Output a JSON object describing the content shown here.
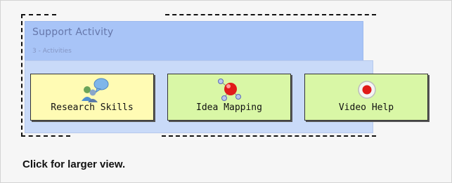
{
  "activity_panel": {
    "title": "Support Activity",
    "subtitle": "3 - Activities",
    "buttons": [
      {
        "label": "Research Skills",
        "icon": "users-chat-icon",
        "color": "#fffbb4"
      },
      {
        "label": "Idea Mapping",
        "icon": "molecule-icon",
        "color": "#d9f7a6"
      },
      {
        "label": "Video Help",
        "icon": "record-icon",
        "color": "#d9f7a6"
      }
    ]
  },
  "caption": "Click for larger view.",
  "colors": {
    "header_bg": "#a8c4f7",
    "body_bg": "#c9daf8",
    "frame_bg": "#f6f6f6"
  }
}
